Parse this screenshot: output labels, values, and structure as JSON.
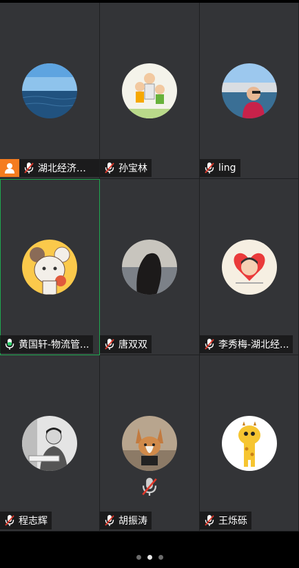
{
  "participants": [
    {
      "name": "湖北经济学...",
      "mic": "muted",
      "host": true,
      "avatar": "sea-photo"
    },
    {
      "name": "孙宝林",
      "mic": "muted",
      "avatar": "cartoon-family"
    },
    {
      "name": "ling",
      "mic": "muted",
      "avatar": "harbor-selfie"
    },
    {
      "name": "黄国轩-物流管...",
      "mic": "active",
      "speaking": true,
      "avatar": "cartoon-mouse"
    },
    {
      "name": "唐双双",
      "mic": "muted",
      "avatar": "silhouette-portrait"
    },
    {
      "name": "李秀梅-湖北经...",
      "mic": "muted",
      "avatar": "cartoon-girl"
    },
    {
      "name": "程志辉",
      "mic": "muted",
      "avatar": "reading-man"
    },
    {
      "name": "胡振涛",
      "mic": "muted",
      "avatar": "corgi-dog",
      "center_mic_muted": true
    },
    {
      "name": "王烁砾",
      "mic": "muted",
      "avatar": "cartoon-giraffe"
    }
  ],
  "pagination": {
    "pages": 3,
    "current": 2
  },
  "colors": {
    "host_badge": "#f57c1f",
    "active_border": "#1ea84f",
    "tile_bg": "#333437"
  }
}
